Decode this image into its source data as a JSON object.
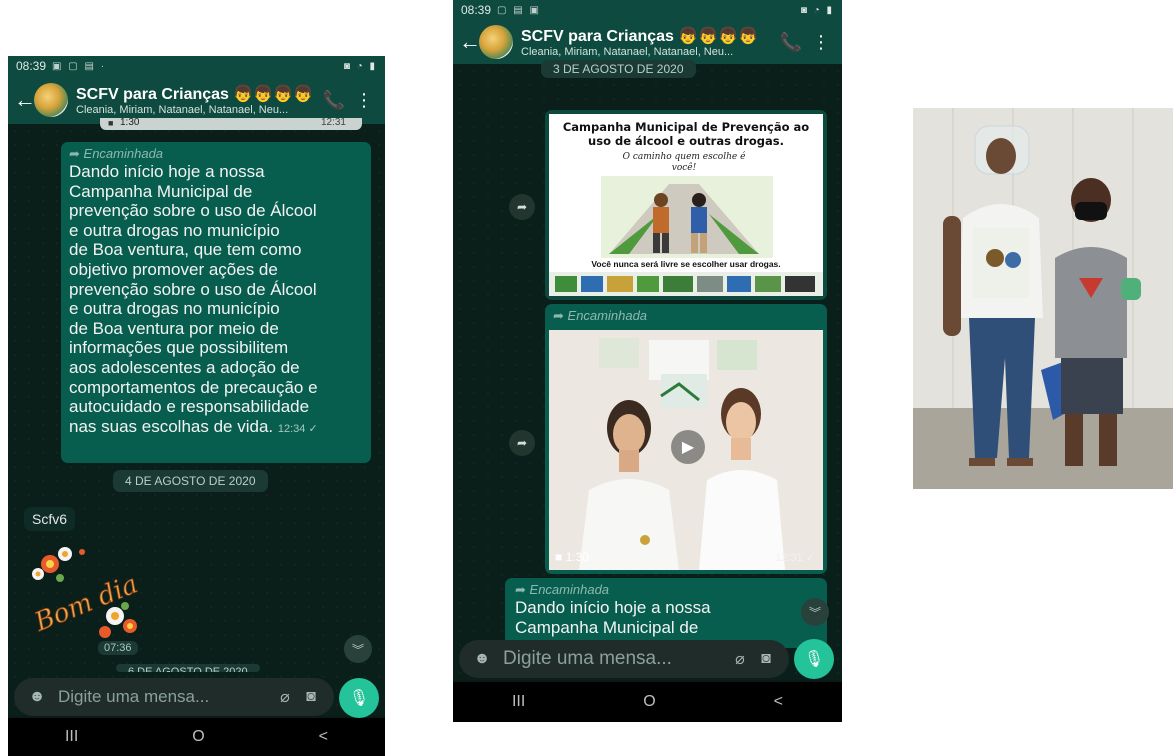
{
  "phone1": {
    "status": {
      "time": "08:39"
    },
    "header": {
      "title": "SCFV para Crianças",
      "subtitle": "Cleania, Miriam, Natanael, Natanael, Neu..."
    },
    "video_partial": {
      "duration": "1:30",
      "time": "12:31"
    },
    "message": {
      "forwarded_label": "Encaminhada",
      "lines": [
        "Dando início hoje a nossa",
        "Campanha Municipal de",
        "prevenção sobre o uso de Álcool",
        "e outra drogas no município",
        "de Boa ventura, que tem como",
        "objetivo promover ações de",
        "prevenção sobre o uso de Álcool",
        "e outra drogas no município",
        "de Boa ventura por meio de",
        "informações que possibilitem",
        "aos adolescentes a adoção de",
        "comportamentos de precaução e",
        "autocuidado e responsabilidade",
        "nas suas escolhas de vida."
      ],
      "time": "12:34"
    },
    "date_1": "4 DE AGOSTO DE 2020",
    "incoming_sender": "Scfv6",
    "sticker_text": "Bom dia",
    "sticker_time": "07:36",
    "date_2_partial": "6 DE AGOSTO DE 2020",
    "input": {
      "placeholder": "Digite uma mensa..."
    },
    "nav": {
      "recent": "III",
      "home": "O",
      "back": "<"
    }
  },
  "phone2": {
    "status": {
      "time": "08:39"
    },
    "header": {
      "title": "SCFV para Crianças",
      "subtitle": "Cleania, Miriam, Natanael, Natanael, Neu..."
    },
    "date_top": "3 DE AGOSTO DE 2020",
    "poster": {
      "title": "Campanha Municipal de Prevenção ao uso de álcool e outras drogas.",
      "tagline": "O caminho quem escolhe é você!",
      "footer": "Você nunca será livre se escolher usar drogas."
    },
    "forwarded_label": "Encaminhada",
    "video": {
      "duration": "1:30",
      "time": "12:31"
    },
    "message_partial": {
      "forwarded_label": "Encaminhada",
      "line1": "Dando início hoje a nossa",
      "line2": "Campanha Municipal de"
    },
    "input": {
      "placeholder": "Digite uma mensa..."
    },
    "nav": {
      "recent": "III",
      "home": "O",
      "back": "<"
    }
  },
  "colors": {
    "header_bg": "#0e4a3f",
    "bubble_out": "#075e4f",
    "chat_bg": "#0b1f1a",
    "mic_button": "#25c39a"
  },
  "icons": [
    "back-arrow-icon",
    "group-avatar-icon",
    "add-call-icon",
    "more-vert-icon",
    "emoji-icon",
    "attach-icon",
    "camera-icon",
    "mic-icon",
    "forward-icon",
    "play-icon",
    "video-camera-icon",
    "scroll-down-icon",
    "double-check-icon"
  ]
}
